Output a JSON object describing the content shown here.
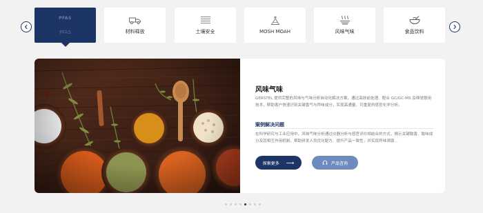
{
  "tabs": [
    {
      "label": "PFAS",
      "icon_text": "PFAS",
      "icon": "pfas-icon",
      "active": true
    },
    {
      "label": "材料释放",
      "icon": "truck-icon",
      "active": false
    },
    {
      "label": "土壤安全",
      "icon": "soil-layers-icon",
      "active": false
    },
    {
      "label": "MOSH MOAH",
      "icon": "flask-icon",
      "active": false
    },
    {
      "label": "风味气味",
      "icon": "steam-icon",
      "active": false
    },
    {
      "label": "食品饮料",
      "icon": "bowl-icon",
      "active": false
    }
  ],
  "slide": {
    "title": "风味气味",
    "description": "GERSTEL 提供完整的风味与气味分析自动化解决方案，通过高效前处理、配合 GC/GC-MS 及嗅觉联用技术，帮助客户快速识别关键香气与异味成分，实现高通量、可重复的感官化学分析。",
    "case_heading": "案例解决问题",
    "case_text": "在科学研究与工业应用中，风味气味分析通过仪器分析与感官评价相结合的方式，揭示关键致香、致味成分及其相互作用机制，帮助研发人员优化配方、提升产品一致性，并实现异味溯源…",
    "explore_label": "探索更多",
    "consult_label": "产品咨询"
  },
  "pagination": {
    "count": 8,
    "active": 4
  },
  "colors": {
    "navy": "#1d3565",
    "accent": "#6f8bbd",
    "background": "#f2f2f3"
  }
}
